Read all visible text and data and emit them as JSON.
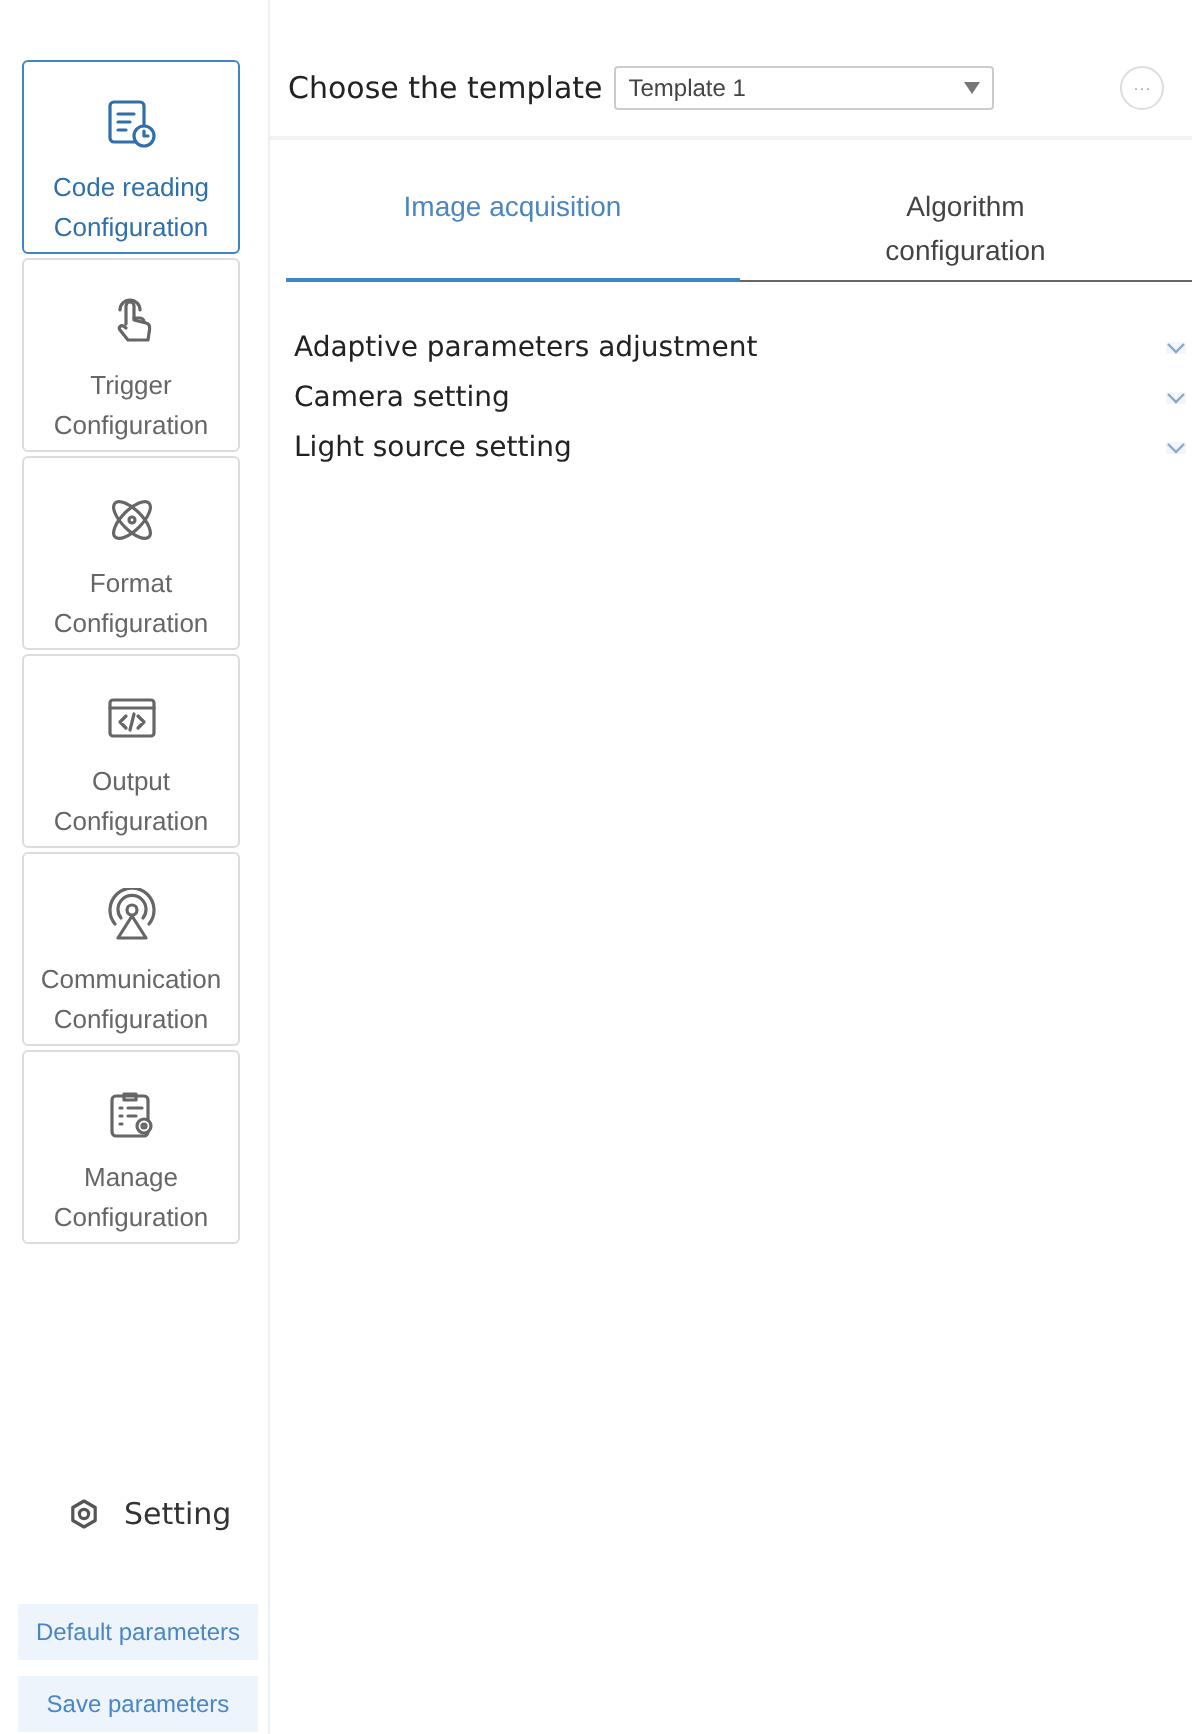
{
  "nav_items": [
    {
      "kind": "code-reading",
      "label": "Code reading Configuration",
      "selected": true
    },
    {
      "kind": "trigger",
      "label": "Trigger Configuration",
      "selected": false
    },
    {
      "kind": "format",
      "label": "Format Configuration",
      "selected": false
    },
    {
      "kind": "output",
      "label": "Output Configuration",
      "selected": false
    },
    {
      "kind": "communication",
      "label": "Communication Configuration",
      "selected": false
    },
    {
      "kind": "manage",
      "label": "Manage Configuration",
      "selected": false
    }
  ],
  "setting": {
    "label": "Setting"
  },
  "buttons": [
    "Default parameters",
    "Save parameters"
  ],
  "template": {
    "label": "Choose the template",
    "value": "Template 1",
    "more": "···"
  },
  "tabs": [
    {
      "label": "Image acquisition",
      "selected": true
    },
    {
      "label": "Algorithm configuration",
      "selected": false
    }
  ],
  "sections": [
    {
      "title": "Adaptive parameters adjustment"
    },
    {
      "title": "Camera setting"
    },
    {
      "title": "Light source setting"
    }
  ]
}
